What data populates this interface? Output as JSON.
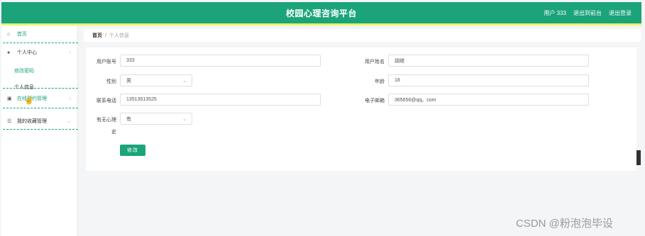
{
  "header": {
    "title": "校园心理咨询平台",
    "user_label": "用户 333",
    "back_link": "退出到前台",
    "logout_link": "退出登录"
  },
  "sidebar": {
    "items": [
      {
        "label": "首页",
        "icon": "home-icon"
      },
      {
        "label": "个人中心",
        "icon": "user-icon"
      },
      {
        "label": "在线预约管理",
        "icon": "calendar-icon"
      },
      {
        "label": "我的收藏管理",
        "icon": "list-icon"
      }
    ],
    "sub_items": [
      "修改密码",
      "个人信息"
    ]
  },
  "breadcrumb": {
    "home": "首页",
    "sep": "/",
    "current": "个人信息"
  },
  "form": {
    "account_label": "用户账号",
    "account_value": "333",
    "name_label": "用户姓名",
    "name_value": "胡继",
    "gender_label": "性别",
    "gender_value": "男",
    "age_label": "年龄",
    "age_value": "18",
    "phone_label": "联系电话",
    "phone_value": "13513513525",
    "email_label": "电子邮箱",
    "email_value": "365656@qq。com",
    "history_label_line1": "有无心理",
    "history_label_line2": "史",
    "history_value": "有",
    "submit_label": "修改"
  },
  "watermark": "CSDN @粉泡泡毕设",
  "colors": {
    "primary": "#1ba37a",
    "accent": "#e5f46b"
  }
}
